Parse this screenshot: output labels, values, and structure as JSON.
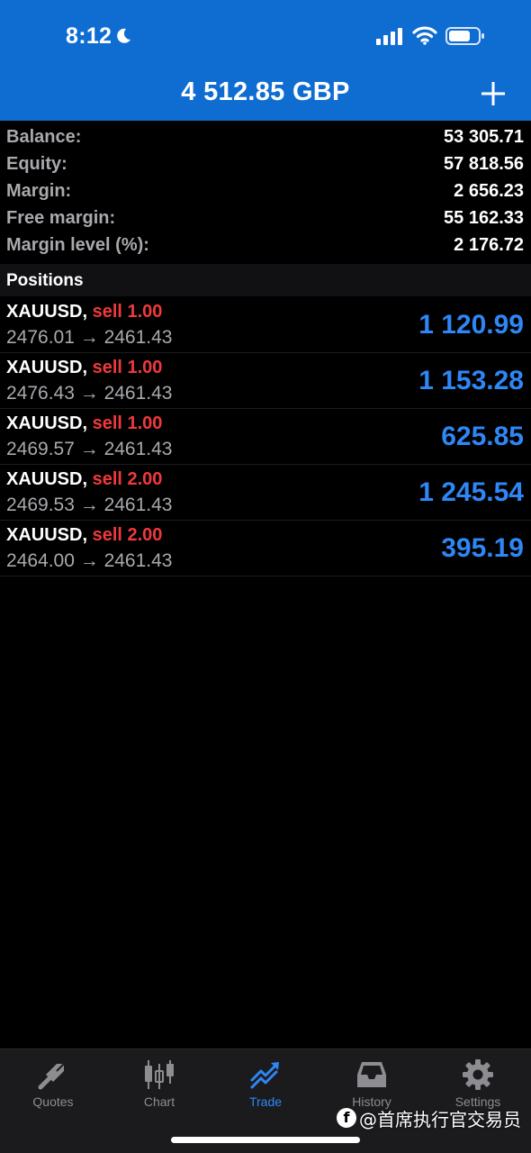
{
  "status_bar": {
    "time": "8:12"
  },
  "header": {
    "title": "4 512.85 GBP"
  },
  "summary": [
    {
      "label": "Balance:",
      "value": "53 305.71"
    },
    {
      "label": "Equity:",
      "value": "57 818.56"
    },
    {
      "label": "Margin:",
      "value": "2 656.23"
    },
    {
      "label": "Free margin:",
      "value": "55 162.33"
    },
    {
      "label": "Margin level (%):",
      "value": "2 176.72"
    }
  ],
  "positions": {
    "title": "Positions",
    "items": [
      {
        "symbol": "XAUUSD,",
        "side": "sell 1.00",
        "prices": "2476.01 → 2461.43",
        "profit": "1 120.99"
      },
      {
        "symbol": "XAUUSD,",
        "side": "sell 1.00",
        "prices": "2476.43 → 2461.43",
        "profit": "1 153.28"
      },
      {
        "symbol": "XAUUSD,",
        "side": "sell 1.00",
        "prices": "2469.57 → 2461.43",
        "profit": "625.85"
      },
      {
        "symbol": "XAUUSD,",
        "side": "sell 2.00",
        "prices": "2469.53 → 2461.43",
        "profit": "1 245.54"
      },
      {
        "symbol": "XAUUSD,",
        "side": "sell 2.00",
        "prices": "2464.00 → 2461.43",
        "profit": "395.19"
      }
    ]
  },
  "tabs": [
    {
      "label": "Quotes",
      "icon": "quotes-icon"
    },
    {
      "label": "Chart",
      "icon": "candlestick-icon"
    },
    {
      "label": "Trade",
      "icon": "trade-icon",
      "active": true
    },
    {
      "label": "History",
      "icon": "inbox-icon"
    },
    {
      "label": "Settings",
      "icon": "gear-icon"
    }
  ],
  "watermark": {
    "text": "@首席执行官交易员"
  },
  "colors": {
    "header": "#0f6dd2",
    "sell": "#f0393b",
    "profit": "#2f86f5",
    "active_tab": "#2f86f5"
  }
}
